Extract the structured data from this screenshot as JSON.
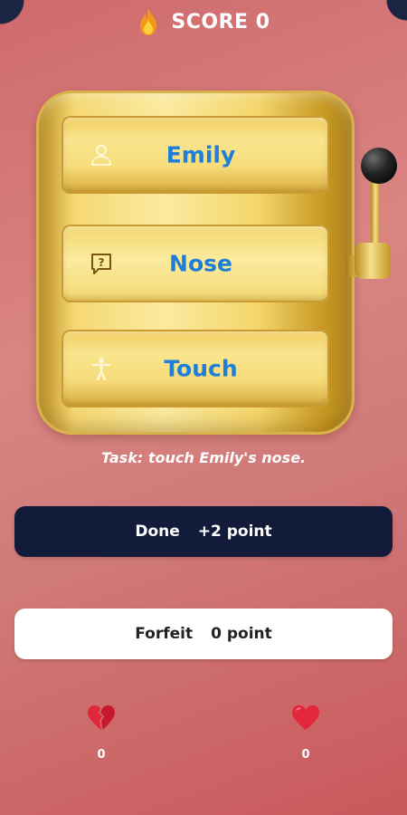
{
  "header": {
    "score_label": "SCORE 0",
    "icon": "flame-icon"
  },
  "reels": [
    {
      "icon": "person-icon",
      "label": "Emily"
    },
    {
      "icon": "question-bubble-icon",
      "label": "Nose"
    },
    {
      "icon": "action-figure-icon",
      "label": "Touch"
    }
  ],
  "task_text": "Task: touch Emily's nose.",
  "buttons": {
    "done": {
      "label": "Done",
      "points": "+2 point"
    },
    "forfeit": {
      "label": "Forfeit",
      "points": "0 point"
    }
  },
  "stats": {
    "broken_hearts": {
      "icon": "broken-heart-icon",
      "count": "0"
    },
    "hearts": {
      "icon": "heart-icon",
      "count": "0"
    }
  },
  "colors": {
    "accent_blue": "#1f7fd8",
    "done_button": "#121c3a",
    "background": "#d07a78",
    "gold": "#f5d873"
  }
}
